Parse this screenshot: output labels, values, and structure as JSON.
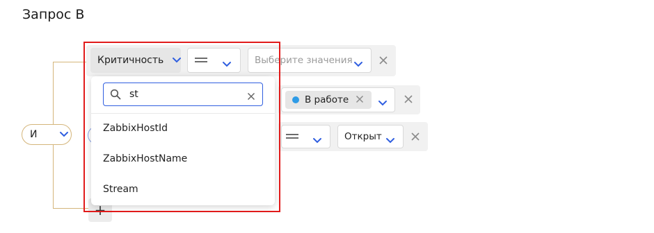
{
  "title": "Запрос В",
  "logic": {
    "operator_label": "И"
  },
  "rows": [
    {
      "field": "Критичность",
      "operator": "=",
      "value_placeholder": "Выберите значения"
    },
    {
      "value_tag": "В работе",
      "tag_color": "#2e9be6"
    },
    {
      "operator": "=",
      "value": "Открыт"
    }
  ],
  "dropdown": {
    "search_value": "st",
    "options": [
      "ZabbixHostId",
      "ZabbixHostName",
      "Stream"
    ]
  },
  "add_label": "+",
  "colors": {
    "accent": "#2f5ee0",
    "bracket": "#d4b57a",
    "highlight": "#e11a1a"
  }
}
